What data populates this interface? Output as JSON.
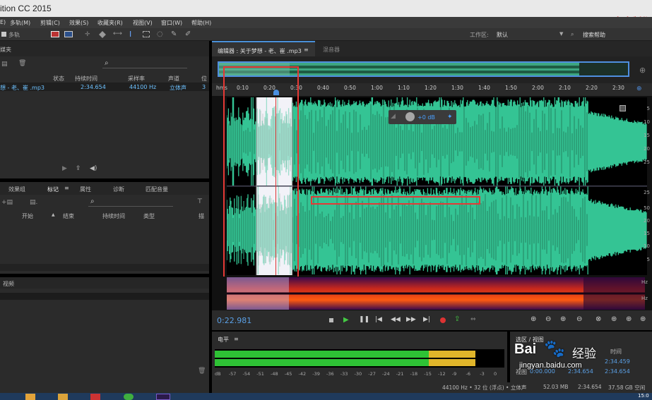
{
  "window": {
    "title": "ition CC 2015",
    "watermark": "老崔制作"
  },
  "menu": [
    "E)",
    "多轨(M)",
    "剪辑(C)",
    "效果(S)",
    "收藏夹(R)",
    "视图(V)",
    "窗口(W)",
    "帮助(H)"
  ],
  "toolbar": {
    "view_label": "多轨",
    "workspace_label": "工作区:",
    "workspace_value": "默认",
    "help_search": "搜索帮助"
  },
  "files_panel": {
    "title": "媒夹",
    "columns": [
      "状态",
      "持续时间",
      "采样率",
      "声道",
      "位"
    ],
    "row": {
      "name": "想 - 老、崔 .mp3",
      "duration": "2:34.654",
      "sample_rate": "44100 Hz",
      "channels": "立体声",
      "bits": "3"
    }
  },
  "markers_panel": {
    "tabs": [
      "效果组",
      "标记",
      "属性",
      "诊断",
      "匹配音量"
    ],
    "columns": [
      "开始",
      "结束",
      "持续时间",
      "类型",
      "描"
    ]
  },
  "video_panel": {
    "title": "视频"
  },
  "editor": {
    "tab_title": "编辑器 : 关于梦想 - 老、崔 .mp3",
    "mixer_tab": "混音器",
    "hud_gain": "+0 dB",
    "ruler_start": "hms",
    "time_ticks": [
      "0:10",
      "0:20",
      "0:30",
      "0:40",
      "0:50",
      "1:00",
      "1:10",
      "1:20",
      "1:30",
      "1:40",
      "1:50",
      "2:00",
      "2:10",
      "2:20",
      "2:30"
    ],
    "db_scale": [
      "5",
      "10",
      "15",
      "20",
      "25",
      "50",
      "25",
      "20",
      "15",
      "10",
      "5"
    ],
    "spectral_hz": [
      "Hz",
      "Hz"
    ],
    "current_time": "0:22.981",
    "selection_fraction": [
      0.07,
      0.155
    ]
  },
  "level_meter": {
    "title": "电平",
    "green_fraction": 0.74,
    "yellow_fraction": 0.16,
    "scale": [
      "dB",
      "-57",
      "-54",
      "-51",
      "-48",
      "-45",
      "-42",
      "-39",
      "-36",
      "-33",
      "-30",
      "-27",
      "-24",
      "-21",
      "-18",
      "-15",
      "-12",
      "-9",
      "-6",
      "-3",
      "0"
    ]
  },
  "selection_panel": {
    "title": "选区 / 视图",
    "header": "时间",
    "row_sel_end": "2:34.459",
    "view_label": "视图",
    "view_start": "0:00.000",
    "view_end": "2:34.654",
    "view_dur": "2:34.654"
  },
  "status": {
    "format": "44100 Hz • 32 位 (浮点) • 立体声",
    "size": "52.03 MB",
    "duration": "2:34.654",
    "free": "37.58 GB 空闲"
  },
  "baidu": {
    "logo": "Bai",
    "logo_suffix": "经验",
    "url": "jingyan.baidu.com"
  },
  "taskbar": {
    "clock": "15:0"
  },
  "colors": {
    "waveform": "#34c494",
    "waveform_dark": "#1b4733",
    "selection": "#f2f2f8",
    "accent": "#5aa0e6",
    "red_box": "#e53935",
    "meter_green": "#2ec235",
    "meter_yellow": "#e0b52a"
  }
}
